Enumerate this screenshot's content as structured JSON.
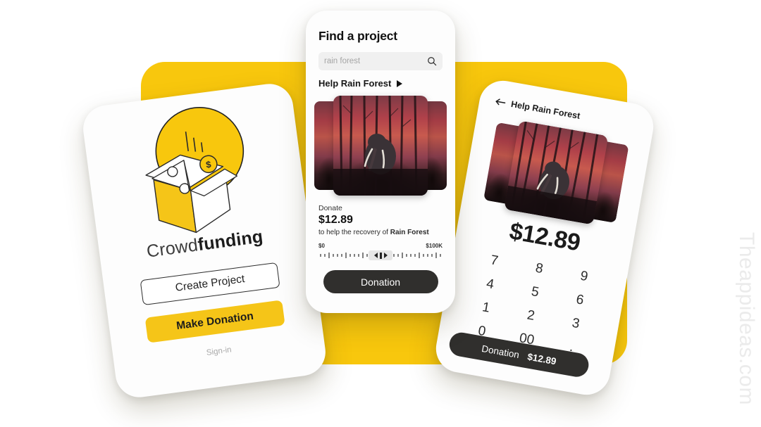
{
  "watermark": "Theappideas.com",
  "colors": {
    "brand_yellow": "#F8C70D",
    "button_yellow": "#F5C518",
    "dark": "#302f2d"
  },
  "phone_left": {
    "brand_light": "Crowd",
    "brand_bold": "funding",
    "create_project": "Create Project",
    "make_donation": "Make Donation",
    "signin": "Sign-in",
    "illustration": "open-box-with-coin"
  },
  "phone_middle": {
    "title": "Find a project",
    "search_placeholder": "rain forest",
    "search_icon": "search-icon",
    "section_title": "Help Rain Forest",
    "play_icon": "play-triangle-icon",
    "image_alt": "elephant-in-red-forest",
    "donate_label": "Donate",
    "donate_amount": "$12.89",
    "donate_desc_prefix": "to help the recovery of ",
    "donate_desc_project": "Rain Forest",
    "range_min": "$0",
    "range_max": "$100K",
    "cta": "Donation"
  },
  "phone_right": {
    "back_icon": "arrow-left-icon",
    "header": "Help Rain Forest",
    "image_alt": "elephant-in-red-forest",
    "amount": "$12.89",
    "keys": [
      "7",
      "8",
      "9",
      "4",
      "5",
      "6",
      "1",
      "2",
      "3",
      "0",
      "00",
      "."
    ],
    "cta_label": "Donation",
    "cta_amount": "$12.89"
  }
}
